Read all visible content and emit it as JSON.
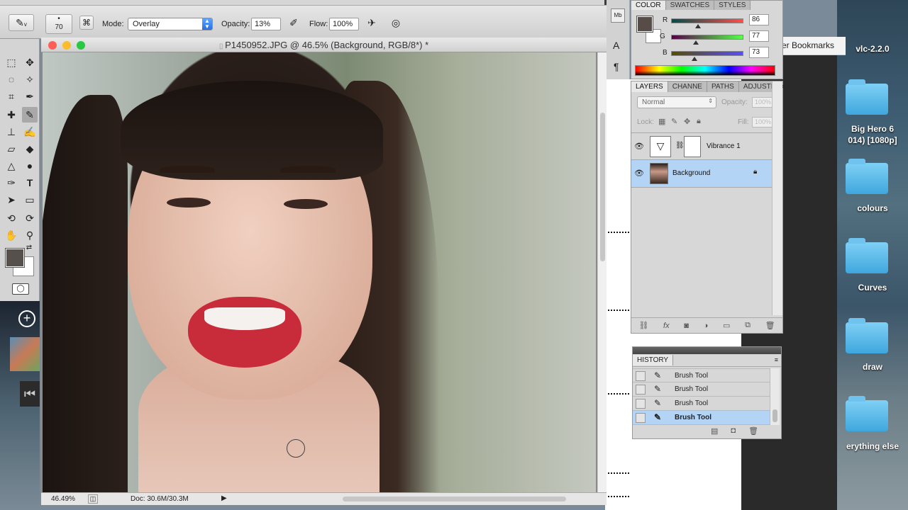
{
  "options_bar": {
    "brush_size": "70",
    "mode_label": "Mode:",
    "mode_value": "Overlay",
    "opacity_label": "Opacity:",
    "opacity_value": "13%",
    "flow_label": "Flow:",
    "flow_value": "100%"
  },
  "document": {
    "title": "P1450952.JPG @ 46.5% (Background, RGB/8*) *",
    "zoom": "46.49%",
    "doc_size": "Doc: 30.6M/30.3M"
  },
  "color_panel": {
    "tabs": [
      "COLOR",
      "SWATCHES",
      "STYLES"
    ],
    "r_label": "R",
    "r_value": "86",
    "g_label": "G",
    "g_value": "77",
    "b_label": "B",
    "b_value": "73",
    "fg_color": "#564d49"
  },
  "layers_panel": {
    "tabs": [
      "LAYERS",
      "CHANNE",
      "PATHS",
      "ADJUSTI"
    ],
    "blend_mode": "Normal",
    "opacity_label": "Opacity:",
    "opacity_value": "100%",
    "lock_label": "Lock:",
    "fill_label": "Fill:",
    "fill_value": "100%",
    "layers": [
      {
        "name": "Vibrance 1",
        "selected": false
      },
      {
        "name": "Background",
        "selected": true
      }
    ]
  },
  "history_panel": {
    "title": "HISTORY",
    "items": [
      {
        "label": "Brush Tool",
        "selected": false
      },
      {
        "label": "Brush Tool",
        "selected": false
      },
      {
        "label": "Brush Tool",
        "selected": false
      },
      {
        "label": "Brush Tool",
        "selected": true
      }
    ]
  },
  "browser": {
    "bookmarks_label": "er Bookmarks"
  },
  "desktop": {
    "items": [
      "vlc-2.2.0",
      "Big Hero 6",
      "014) [1080p]",
      "colours",
      "Curves",
      "draw",
      "erything else"
    ]
  }
}
